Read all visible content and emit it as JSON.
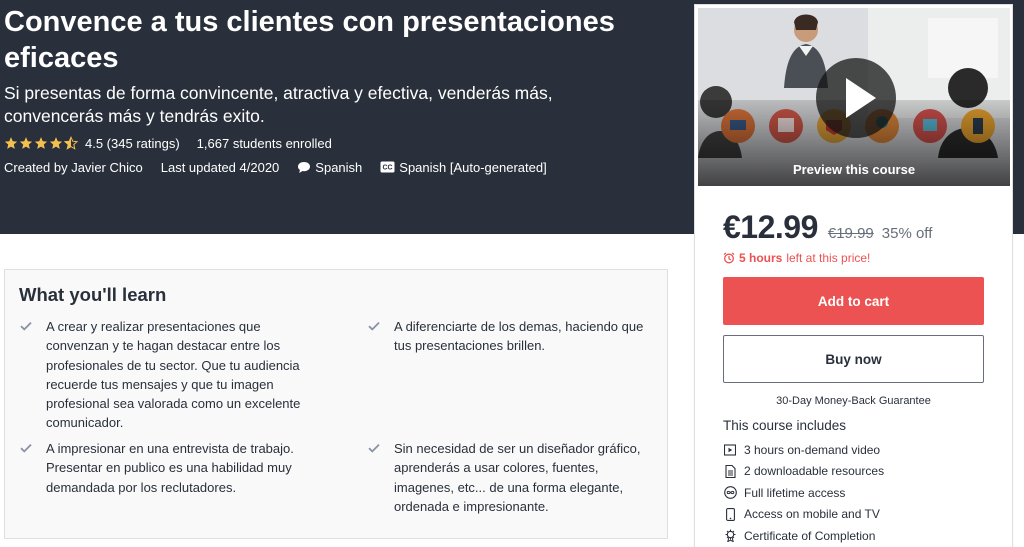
{
  "header": {
    "title": "Convence a tus clientes con presentaciones eficaces",
    "subtitle": "Si presentas de forma convincente, atractiva y efectiva, venderás más, convencerás más y tendrás exito.",
    "rating": {
      "value": 4.5,
      "stars_label": "4.5 (345 ratings)",
      "enrolled": "1,667 students enrolled"
    },
    "created_by": "Created by Javier Chico",
    "last_updated": "Last updated 4/2020",
    "language": "Spanish",
    "captions": "Spanish [Auto-generated]"
  },
  "colors": {
    "header_bg": "#29303b",
    "accent": "#ec5252",
    "star": "#f4c150",
    "learn_bg": "#f9f9f9"
  },
  "sidebar": {
    "preview_label": "Preview this course",
    "price": "€12.99",
    "original_price": "€19.99",
    "discount": "35% off",
    "timer_bold": "5 hours",
    "timer_rest": "left at this price!",
    "add_to_cart": "Add to cart",
    "buy_now": "Buy now",
    "guarantee": "30-Day Money-Back Guarantee",
    "includes_title": "This course includes",
    "includes": [
      {
        "icon": "video-icon",
        "label": "3 hours on-demand video"
      },
      {
        "icon": "file-icon",
        "label": "2 downloadable resources"
      },
      {
        "icon": "infinity-icon",
        "label": "Full lifetime access"
      },
      {
        "icon": "mobile-icon",
        "label": "Access on mobile and TV"
      },
      {
        "icon": "certificate-icon",
        "label": "Certificate of Completion"
      }
    ]
  },
  "learn": {
    "title": "What you'll learn",
    "items": [
      "A crear y realizar presentaciones que convenzan y te hagan destacar entre los profesionales de tu sector. Que tu audiencia recuerde tus mensajes y que tu imagen profesional sea valorada como un excelente comunicador.",
      "A diferenciarte de los demas, haciendo que tus presentaciones brillen.",
      "A impresionar en una entrevista de trabajo. Presentar en publico es una habilidad muy demandada por los reclutadores.",
      "Sin necesidad de ser un diseñador gráfico, aprenderás a usar colores, fuentes, imagenes, etc... de una forma elegante, ordenada e impresionante."
    ]
  }
}
